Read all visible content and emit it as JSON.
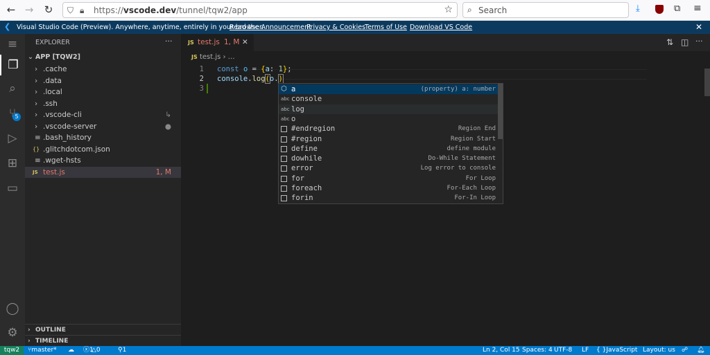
{
  "browser": {
    "url_prefix": "https://",
    "url_domain": "vscode.dev",
    "url_path": "/tunnel/tqw2/app",
    "search_placeholder": "Search"
  },
  "banner": {
    "text": "Visual Studio Code (Preview). Anywhere, anytime, entirely in your browser.",
    "links": [
      "Read the Announcement",
      "Privacy & Cookies",
      "Terms of Use",
      "Download VS Code"
    ]
  },
  "activity": {
    "scm_badge": "5"
  },
  "sidebar": {
    "title": "EXPLORER",
    "more": "···",
    "root": "APP [TQW2]",
    "items": [
      {
        "name": ".cache",
        "type": "folder",
        "decoration": ""
      },
      {
        "name": ".data",
        "type": "folder",
        "decoration": ""
      },
      {
        "name": ".local",
        "type": "folder",
        "decoration": ""
      },
      {
        "name": ".ssh",
        "type": "folder",
        "decoration": ""
      },
      {
        "name": ".vscode-cli",
        "type": "folder",
        "decoration": "↳"
      },
      {
        "name": ".vscode-server",
        "type": "folder",
        "decoration": "●"
      },
      {
        "name": ".bash_history",
        "type": "file",
        "decoration": ""
      },
      {
        "name": ".glitchdotcom.json",
        "type": "json",
        "decoration": ""
      },
      {
        "name": ".wget-hsts",
        "type": "file",
        "decoration": ""
      },
      {
        "name": "test.js",
        "type": "js",
        "decoration": "1, M"
      }
    ],
    "outline": "OUTLINE",
    "timeline": "TIMELINE"
  },
  "editor": {
    "tab": {
      "name": "test.js",
      "status": "1, M"
    },
    "breadcrumb": {
      "file": "test.js",
      "rest": "…"
    },
    "lines": [
      {
        "n": "1",
        "text": "const o = {a: 1};"
      },
      {
        "n": "2",
        "text": "console.log(o.)"
      },
      {
        "n": "3",
        "text": ""
      }
    ]
  },
  "suggest": [
    {
      "icon": "property",
      "label": "a",
      "detail": "(property) a: number"
    },
    {
      "icon": "abc",
      "label": "console",
      "detail": ""
    },
    {
      "icon": "abc",
      "label": "log",
      "detail": ""
    },
    {
      "icon": "abc",
      "label": "o",
      "detail": ""
    },
    {
      "icon": "snippet",
      "label": "#endregion",
      "detail": "Region End"
    },
    {
      "icon": "snippet",
      "label": "#region",
      "detail": "Region Start"
    },
    {
      "icon": "snippet",
      "label": "define",
      "detail": "define module"
    },
    {
      "icon": "snippet",
      "label": "dowhile",
      "detail": "Do-While Statement"
    },
    {
      "icon": "snippet",
      "label": "error",
      "detail": "Log error to console"
    },
    {
      "icon": "snippet",
      "label": "for",
      "detail": "For Loop"
    },
    {
      "icon": "snippet",
      "label": "foreach",
      "detail": "For-Each Loop"
    },
    {
      "icon": "snippet",
      "label": "forin",
      "detail": "For-In Loop"
    }
  ],
  "status": {
    "remote": "tqw2",
    "branch": "master*",
    "errors": "1",
    "warnings": "0",
    "ports": "1",
    "position": "Ln 2, Col 15",
    "spaces": "Spaces: 4",
    "encoding": "UTF-8",
    "eol": "LF",
    "language": "JavaScript",
    "layout": "Layout: us"
  },
  "colors": {
    "statusbar": "#007acc",
    "remote": "#16825d",
    "banner": "#0c3a5f",
    "selected": "#04395e"
  }
}
